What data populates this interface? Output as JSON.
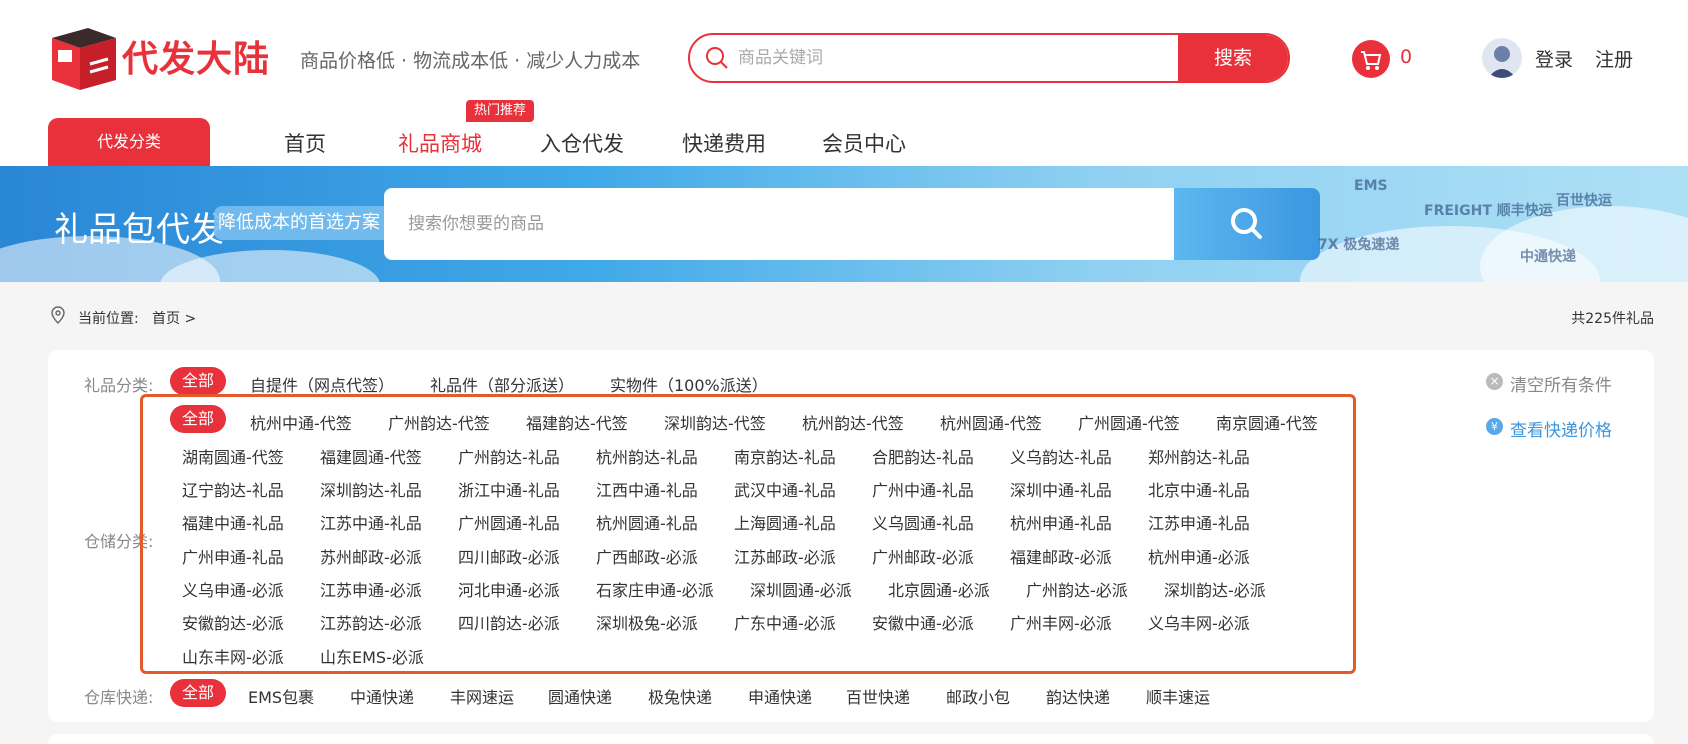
{
  "header": {
    "logo_text": "代发大陆",
    "slogan": "商品价格低 · 物流成本低 · 减少人力成本",
    "search_placeholder": "商品关键词",
    "search_button": "搜索",
    "cart_count": "0",
    "login": "登录",
    "register": "注册"
  },
  "nav": {
    "category_tab": "代发分类",
    "items": [
      "首页",
      "礼品商城",
      "入仓代发",
      "快递费用",
      "会员中心"
    ],
    "active_index": 1,
    "hot_badge": "热门推荐"
  },
  "banner": {
    "title": "礼品包代发",
    "tagline": "降低成本的首选方案",
    "search_placeholder": "搜索你想要的商品",
    "courier_logos": [
      "EMS",
      "FREIGHT 顺丰快运",
      "百世快运",
      "中通快递",
      "7X 极兔速递"
    ]
  },
  "breadcrumb": {
    "label": "当前位置:",
    "home": "首页 >",
    "total": "共225件礼品"
  },
  "filters": {
    "gift_category": {
      "label": "礼品分类:",
      "options": [
        "全部",
        "自提件（网点代签）",
        "礼品件（部分派送）",
        "实物件（100%派送）"
      ]
    },
    "warehouse_category": {
      "label": "仓储分类:",
      "options": [
        "全部",
        "杭州中通-代签",
        "广州韵达-代签",
        "福建韵达-代签",
        "深圳韵达-代签",
        "杭州韵达-代签",
        "杭州圆通-代签",
        "广州圆通-代签",
        "南京圆通-代签",
        "湖南圆通-代签",
        "福建圆通-代签",
        "广州韵达-礼品",
        "杭州韵达-礼品",
        "南京韵达-礼品",
        "合肥韵达-礼品",
        "义乌韵达-礼品",
        "郑州韵达-礼品",
        "辽宁韵达-礼品",
        "深圳韵达-礼品",
        "浙江中通-礼品",
        "江西中通-礼品",
        "武汉中通-礼品",
        "广州中通-礼品",
        "深圳中通-礼品",
        "北京中通-礼品",
        "福建中通-礼品",
        "江苏中通-礼品",
        "广州圆通-礼品",
        "杭州圆通-礼品",
        "上海圆通-礼品",
        "义乌圆通-礼品",
        "杭州申通-礼品",
        "江苏申通-礼品",
        "广州申通-礼品",
        "苏州邮政-必派",
        "四川邮政-必派",
        "广西邮政-必派",
        "江苏邮政-必派",
        "广州邮政-必派",
        "福建邮政-必派",
        "杭州申通-必派",
        "义乌申通-必派",
        "江苏申通-必派",
        "河北申通-必派",
        "石家庄申通-必派",
        "深圳圆通-必派",
        "北京圆通-必派",
        "广州韵达-必派",
        "深圳韵达-必派",
        "安徽韵达-必派",
        "江苏韵达-必派",
        "四川韵达-必派",
        "深圳极兔-必派",
        "广东中通-必派",
        "安徽中通-必派",
        "广州丰网-必派",
        "义乌丰网-必派",
        "山东丰网-必派",
        "山东EMS-必派"
      ]
    },
    "warehouse_courier": {
      "label": "仓库快递:",
      "options": [
        "全部",
        "EMS包裹",
        "中通快递",
        "丰网速运",
        "圆通快递",
        "极兔快递",
        "申通快递",
        "百世快递",
        "邮政小包",
        "韵达快递",
        "顺丰速运"
      ]
    },
    "clear_all": "清空所有条件",
    "view_shipping": "查看快递价格"
  },
  "colors": {
    "brand_red": "#e8313a",
    "highlight_box": "#e55a2b",
    "link_blue": "#3b97e0"
  }
}
